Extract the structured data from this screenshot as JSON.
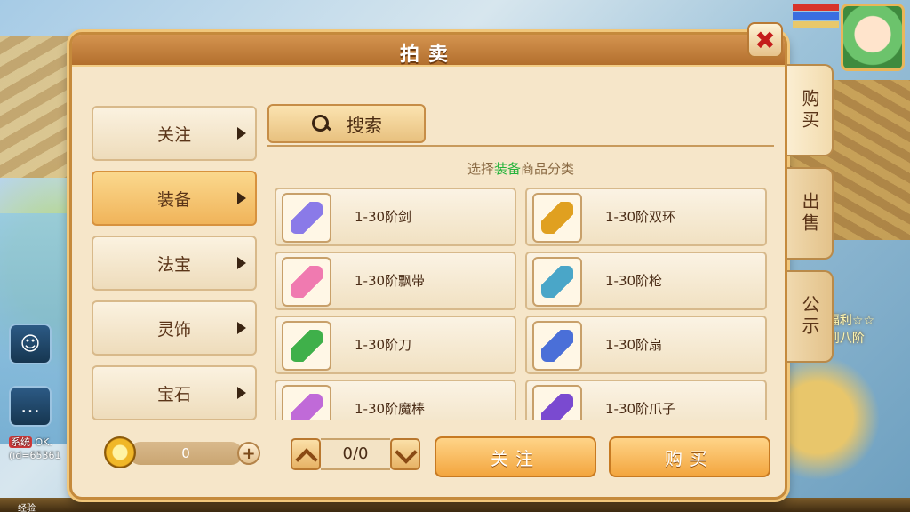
{
  "panel": {
    "title": "拍卖"
  },
  "categories": [
    {
      "label": "关注",
      "active": false
    },
    {
      "label": "装备",
      "active": true
    },
    {
      "label": "法宝",
      "active": false
    },
    {
      "label": "灵饰",
      "active": false
    },
    {
      "label": "宝石",
      "active": false
    }
  ],
  "search": {
    "label": "搜索"
  },
  "hint": {
    "prefix": "选择",
    "highlight": "装备",
    "suffix": "商品分类"
  },
  "items": [
    {
      "label": "1-30阶剑",
      "icon": "sword-icon",
      "color": "#8a7ae8"
    },
    {
      "label": "1-30阶双环",
      "icon": "double-ring-icon",
      "color": "#e0a020"
    },
    {
      "label": "1-30阶飘带",
      "icon": "ribbon-icon",
      "color": "#f07ab0"
    },
    {
      "label": "1-30阶枪",
      "icon": "spear-icon",
      "color": "#4aa6c8"
    },
    {
      "label": "1-30阶刀",
      "icon": "blade-icon",
      "color": "#3fb04a"
    },
    {
      "label": "1-30阶扇",
      "icon": "fan-icon",
      "color": "#4a6fd8"
    },
    {
      "label": "1-30阶魔棒",
      "icon": "wand-icon",
      "color": "#c06ad8"
    },
    {
      "label": "1-30阶爪子",
      "icon": "claw-icon",
      "color": "#7a4ad0"
    }
  ],
  "currency": {
    "value": "0"
  },
  "pager": {
    "value": "0/0"
  },
  "buttons": {
    "follow": "关注",
    "buy": "购买"
  },
  "side_tabs": [
    {
      "label": "购买",
      "active": true
    },
    {
      "label": "出售",
      "active": false
    },
    {
      "label": "公示",
      "active": false
    }
  ],
  "hud": {
    "chat_tag": "系统",
    "chat_text": "OK.",
    "chat_id": "(id=65361",
    "news": "福利☆☆",
    "news2": "到八阶",
    "bottom_label": "经验"
  }
}
